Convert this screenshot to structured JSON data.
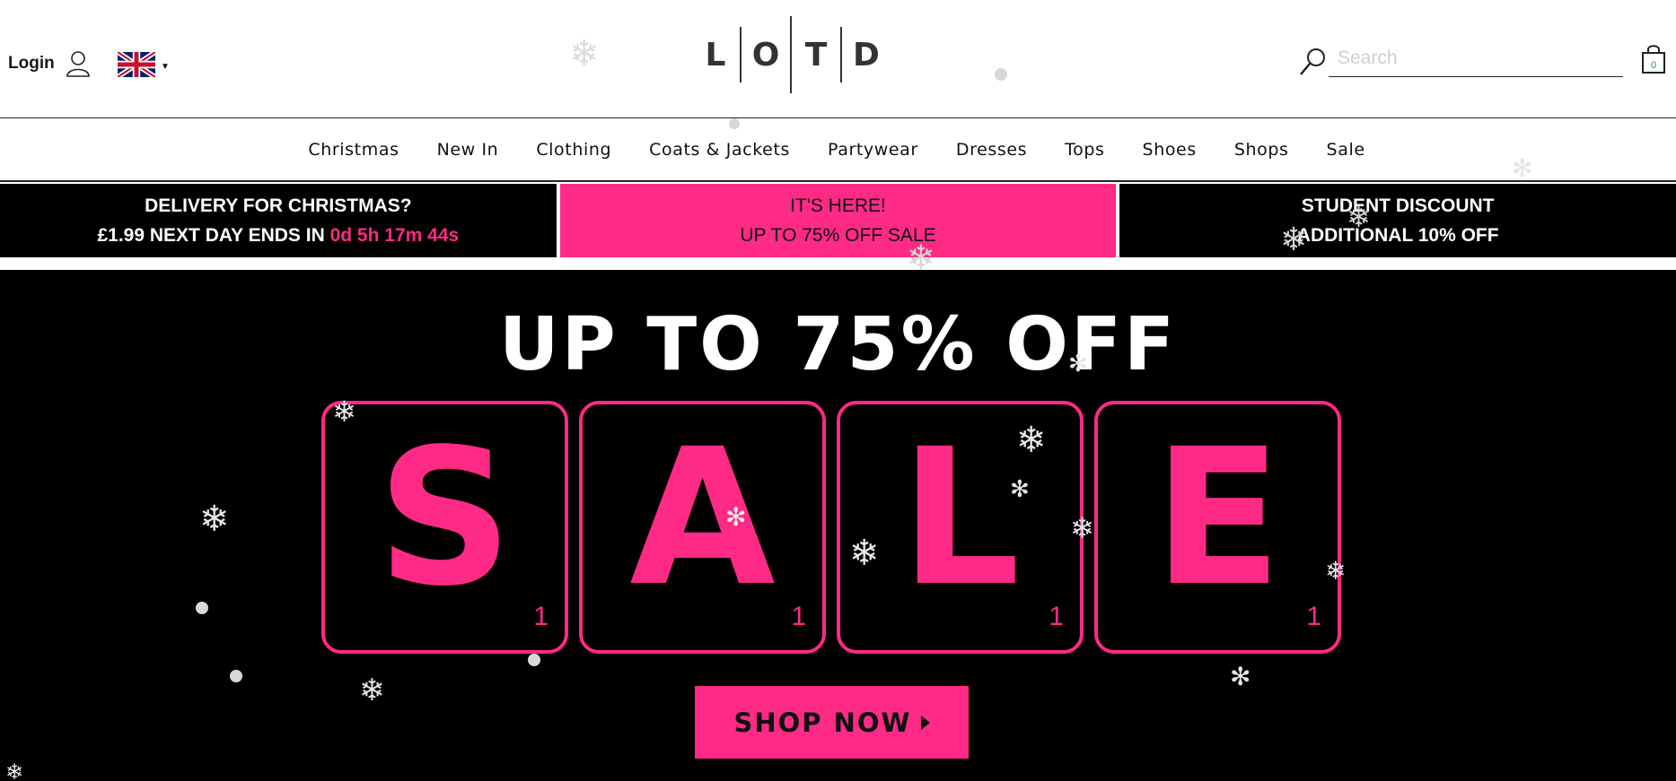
{
  "header": {
    "login_label": "Login",
    "logo_letters": [
      "L",
      "O",
      "T",
      "D"
    ],
    "search_placeholder": "Search",
    "cart_count": "0",
    "icons": {
      "user": "user-icon",
      "flag": "uk-flag-icon",
      "caret": "caret-down-icon",
      "search": "search-icon",
      "cart": "shopping-bag-icon"
    }
  },
  "nav": {
    "items": [
      "Christmas",
      "New In",
      "Clothing",
      "Coats & Jackets",
      "Partywear",
      "Dresses",
      "Tops",
      "Shoes",
      "Shops",
      "Sale"
    ]
  },
  "promos": [
    {
      "line1": "DELIVERY FOR CHRISTMAS?",
      "line2_prefix": "£1.99 NEXT DAY ENDS IN ",
      "countdown": "0d 5h 17m 44s"
    },
    {
      "line1": "IT'S HERE!",
      "line2": "UP TO 75% OFF SALE"
    },
    {
      "line1": "STUDENT DISCOUNT",
      "line2": "ADDITIONAL 10% OFF"
    }
  ],
  "hero": {
    "headline": "UP TO 75% OFF",
    "tiles": [
      {
        "letter": "S",
        "score": "1"
      },
      {
        "letter": "A",
        "score": "1"
      },
      {
        "letter": "L",
        "score": "1"
      },
      {
        "letter": "E",
        "score": "1"
      }
    ],
    "cta_label": "SHOP NOW"
  },
  "colors": {
    "accent_pink": "#ff2a85",
    "black": "#000000",
    "white": "#ffffff"
  }
}
